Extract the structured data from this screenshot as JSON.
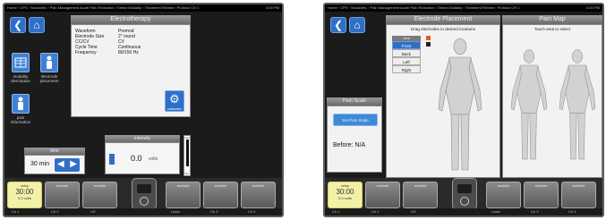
{
  "left": {
    "status_left": "Home › CPS › ShoulderL › Pain Management Acute Pain Reduction › Select Modality › Treatment Review › Protocol CH 1",
    "status_right": "4:00 PM",
    "back_icon": "back-arrow-icon",
    "home_icon": "home-icon",
    "panel_title": "Electrotherapy",
    "params": [
      {
        "label": "Waveform",
        "value": "Premod"
      },
      {
        "label": "Electrode Size",
        "value": "2\" round"
      },
      {
        "label": "CC/CV",
        "value": "CV"
      },
      {
        "label": "Cycle Time",
        "value": "Continuous"
      },
      {
        "label": "Frequency",
        "value": "80/150 Hz"
      }
    ],
    "tiles": [
      {
        "label": "modality description",
        "icon": "grid-icon"
      },
      {
        "label": "electrode placement",
        "icon": "electrode-icon"
      },
      {
        "label": "pain information",
        "icon": "person-icon"
      }
    ],
    "customize_label": "customize",
    "time": {
      "title": "time",
      "value": "30 min"
    },
    "intensity": {
      "title": "intensity",
      "value": "0.0",
      "unit": "volts",
      "level": 0,
      "scale_top": "max",
      "scale_bottom": "min"
    },
    "mode_tiles": [
      {
        "label": "setup",
        "value": "30:00",
        "sub": "0.0 volts",
        "active": true
      },
      {
        "label": "available",
        "value": "",
        "sub": "",
        "active": false
      },
      {
        "label": "available",
        "value": "",
        "sub": "",
        "active": false
      },
      {
        "label": "available",
        "value": "",
        "sub": "",
        "active": false
      },
      {
        "label": "available",
        "value": "",
        "sub": "",
        "active": false
      },
      {
        "label": "available",
        "value": "",
        "sub": "",
        "active": false
      }
    ],
    "strip": [
      "Ch 1",
      "Ch 2",
      "US",
      "Laser",
      "Ch 3",
      "Ch 4"
    ]
  },
  "right": {
    "status_left": "Home › CPS › ShoulderL › Pain Management Acute Pain Reduction › Select Modality › Treatment Review › Protocol CH 1",
    "status_right": "4:00 PM",
    "electrode_title": "Electrode Placement",
    "electrode_instruction": "Drag electrodes to desired locations",
    "view_title": "view",
    "views": [
      "Front",
      "Back",
      "Left",
      "Right"
    ],
    "active_view": "Front",
    "electrode_colors": [
      "#e85a1c",
      "#222222"
    ],
    "painmap_title": "Pain Map",
    "painmap_instruction": "Touch area to select",
    "painscale_title": "Pain Scale",
    "painscale_button": "Set Pain Scale",
    "before_label": "Before: N/A",
    "mode_tiles": [
      {
        "label": "setup",
        "value": "30:00",
        "sub": "0.0 volts",
        "active": true
      },
      {
        "label": "available",
        "value": "",
        "sub": "",
        "active": false
      },
      {
        "label": "available",
        "value": "",
        "sub": "",
        "active": false
      },
      {
        "label": "available",
        "value": "",
        "sub": "",
        "active": false
      },
      {
        "label": "available",
        "value": "",
        "sub": "",
        "active": false
      },
      {
        "label": "available",
        "value": "",
        "sub": "",
        "active": false
      }
    ],
    "strip": [
      "Ch 1",
      "Ch 2",
      "US",
      "Laser",
      "Ch 3",
      "Ch 4"
    ]
  }
}
